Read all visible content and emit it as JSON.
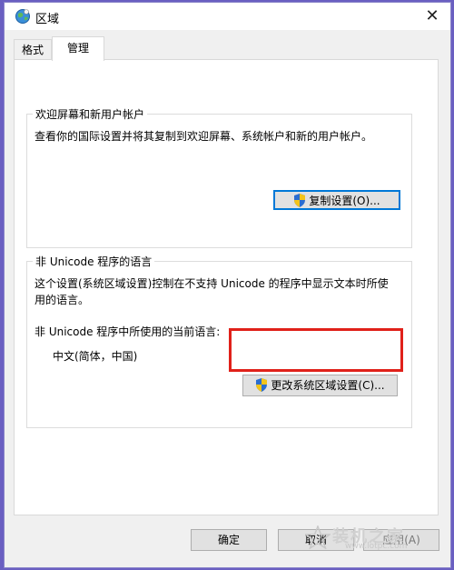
{
  "window": {
    "title": "区域",
    "close_label": "✕"
  },
  "tabs": [
    {
      "label": "格式",
      "selected": false
    },
    {
      "label": "管理",
      "selected": true
    }
  ],
  "welcome_group": {
    "title": "欢迎屏幕和新用户帐户",
    "description": "查看你的国际设置并将其复制到欢迎屏幕、系统帐户和新的用户帐户。",
    "button_label": "复制设置(O)..."
  },
  "unicode_group": {
    "title": "非 Unicode 程序的语言",
    "description_line1": "这个设置(系统区域设置)控制在不支持 Unicode 的程序中显示文本时所使",
    "description_line2": "用的语言。",
    "current_label": "非 Unicode 程序中所使用的当前语言:",
    "current_value": "中文(简体，中国)",
    "button_label": "更改系统区域设置(C)..."
  },
  "footer": {
    "ok_label": "确定",
    "cancel_label": "取消",
    "apply_label": "应用(A)"
  },
  "watermark": {
    "text": "装机之家",
    "url": "www.lotpc.com"
  },
  "colors": {
    "highlight": "#e0211a",
    "focus": "#0078d7",
    "background": "#6a5fc1"
  }
}
